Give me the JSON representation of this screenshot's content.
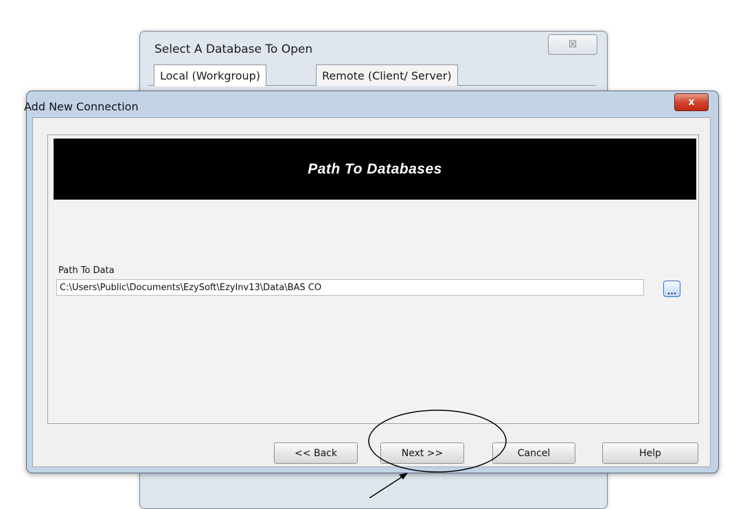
{
  "background_window": {
    "title": "Select A  Database To Open",
    "close_glyph": "☒",
    "tabs": [
      {
        "label": "Local (Workgroup)"
      },
      {
        "label": "Remote (Client/ Server)"
      }
    ]
  },
  "dialog": {
    "title": "Add New Connection",
    "close_glyph": "x",
    "banner": "Path To Databases",
    "path_label": "Path To Data",
    "path_value": "C:\\Users\\Public\\Documents\\EzySoft\\EzyInv13\\Data\\BAS CO",
    "browse_label": "...",
    "buttons": {
      "back": "<< Back",
      "next": "Next >>",
      "cancel": "Cancel",
      "help": "Help"
    }
  },
  "colors": {
    "frame": "#c3d3e6",
    "close_button": "#c8371f",
    "banner_background": "#000000",
    "annotation": "#000000"
  }
}
